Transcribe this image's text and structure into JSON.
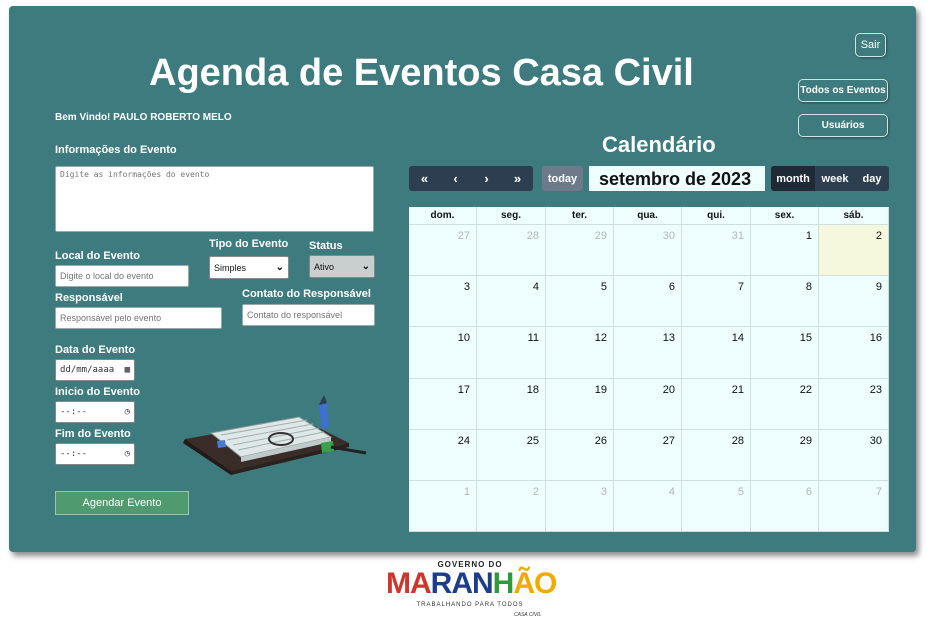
{
  "header": {
    "title": "Agenda de Eventos Casa Civil"
  },
  "nav": {
    "sair": "Sair",
    "todos": "Todos os Eventos",
    "usuarios": "Usuários"
  },
  "welcome": "Bem Vindo! PAULO ROBERTO MELO",
  "form": {
    "info_label": "Informações do Evento",
    "info_placeholder": "Digite as informações do evento",
    "local_label": "Local do Evento",
    "local_placeholder": "Digite o local do evento",
    "tipo_label": "Tipo do Evento",
    "tipo_value": "Simples",
    "status_label": "Status",
    "status_value": "Ativo",
    "responsavel_label": "Responsável",
    "responsavel_placeholder": "Responsável pelo evento",
    "contato_label": "Contato do Responsável",
    "contato_placeholder": "Contato do responsável",
    "data_label": "Data do Evento",
    "data_value": "dd/mm/aaaa",
    "inicio_label": "Inicio do Evento",
    "inicio_value": "--:--",
    "fim_label": "Fim do Evento",
    "fim_value": "--:--",
    "submit_label": "Agendar Evento"
  },
  "calendar": {
    "heading": "Calendário",
    "title": "setembro de 2023",
    "today_label": "today",
    "nav": {
      "prev_year": "«",
      "prev": "‹",
      "next": "›",
      "next_year": "»"
    },
    "views": {
      "month": "month",
      "week": "week",
      "day": "day"
    },
    "weekdays": [
      "dom.",
      "seg.",
      "ter.",
      "qua.",
      "qui.",
      "sex.",
      "sáb."
    ],
    "weeks": [
      [
        {
          "d": "27",
          "o": true
        },
        {
          "d": "28",
          "o": true
        },
        {
          "d": "29",
          "o": true
        },
        {
          "d": "30",
          "o": true
        },
        {
          "d": "31",
          "o": true
        },
        {
          "d": "1"
        },
        {
          "d": "2",
          "t": true
        }
      ],
      [
        {
          "d": "3"
        },
        {
          "d": "4"
        },
        {
          "d": "5"
        },
        {
          "d": "6"
        },
        {
          "d": "7"
        },
        {
          "d": "8"
        },
        {
          "d": "9"
        }
      ],
      [
        {
          "d": "10"
        },
        {
          "d": "11"
        },
        {
          "d": "12"
        },
        {
          "d": "13"
        },
        {
          "d": "14"
        },
        {
          "d": "15"
        },
        {
          "d": "16"
        }
      ],
      [
        {
          "d": "17"
        },
        {
          "d": "18"
        },
        {
          "d": "19"
        },
        {
          "d": "20"
        },
        {
          "d": "21"
        },
        {
          "d": "22"
        },
        {
          "d": "23"
        }
      ],
      [
        {
          "d": "24"
        },
        {
          "d": "25"
        },
        {
          "d": "26"
        },
        {
          "d": "27"
        },
        {
          "d": "28"
        },
        {
          "d": "29"
        },
        {
          "d": "30"
        }
      ],
      [
        {
          "d": "1",
          "o": true
        },
        {
          "d": "2",
          "o": true
        },
        {
          "d": "3",
          "o": true
        },
        {
          "d": "4",
          "o": true
        },
        {
          "d": "5",
          "o": true
        },
        {
          "d": "6",
          "o": true
        },
        {
          "d": "7",
          "o": true
        }
      ]
    ]
  },
  "footer": {
    "gov_small": "GOVERNO DO",
    "gov_name": [
      "MA",
      "RAN",
      "H",
      "ÃO"
    ],
    "gov_sub": "TRABALHANDO PARA TODOS",
    "gov_cc": "CASA CIVIL"
  }
}
